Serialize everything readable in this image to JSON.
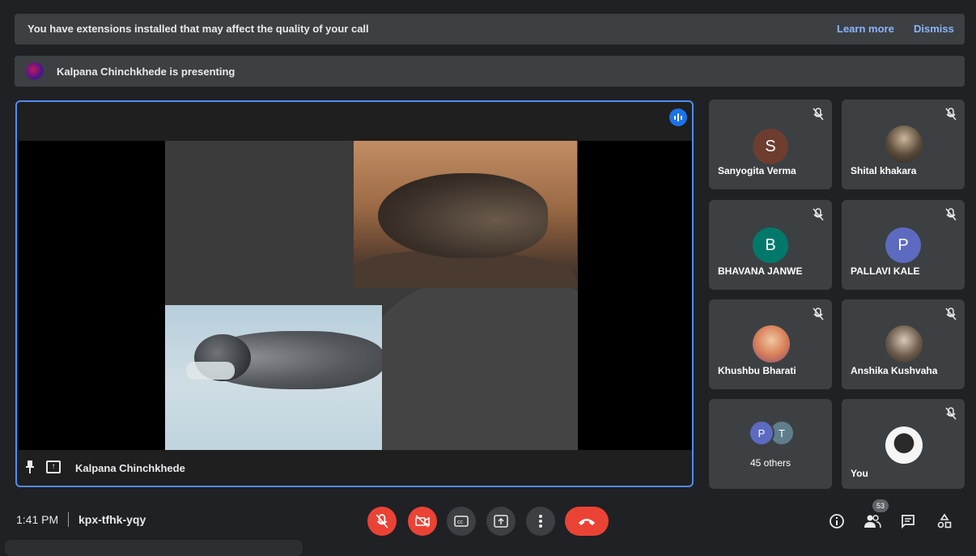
{
  "extension_banner": {
    "message": "You have extensions installed that may affect the quality of your call",
    "learn_more": "Learn more",
    "dismiss": "Dismiss"
  },
  "presenting_banner": {
    "text": "Kalpana Chinchkhede is presenting"
  },
  "main_tile": {
    "presenter_name": "Kalpana Chinchkhede",
    "accent_color": "#4f8df0"
  },
  "participants": [
    {
      "name": "Sanyogita Verma",
      "initial": "S",
      "avatar_color": "#6d3d30"
    },
    {
      "name": "Shital khakara"
    },
    {
      "name": "BHAVANA JANWE",
      "initial": "B",
      "avatar_color": "#00796b"
    },
    {
      "name": "PALLAVI KALE",
      "initial": "P",
      "avatar_color": "#5c6bc0"
    },
    {
      "name": "Khushbu Bharati"
    },
    {
      "name": "Anshika Kushvaha"
    }
  ],
  "others": {
    "initials": [
      "P",
      "T"
    ],
    "count_label": "45 others"
  },
  "self_tile": {
    "name": "You"
  },
  "bottom": {
    "time": "1:41 PM",
    "meeting_code": "kpx-tfhk-yqy",
    "participant_count": "53"
  },
  "icons": [
    "mic-off-icon",
    "camera-off-icon",
    "captions-icon",
    "present-icon",
    "more-vert-icon",
    "call-end-icon",
    "info-icon",
    "people-icon",
    "chat-icon",
    "activities-icon"
  ]
}
